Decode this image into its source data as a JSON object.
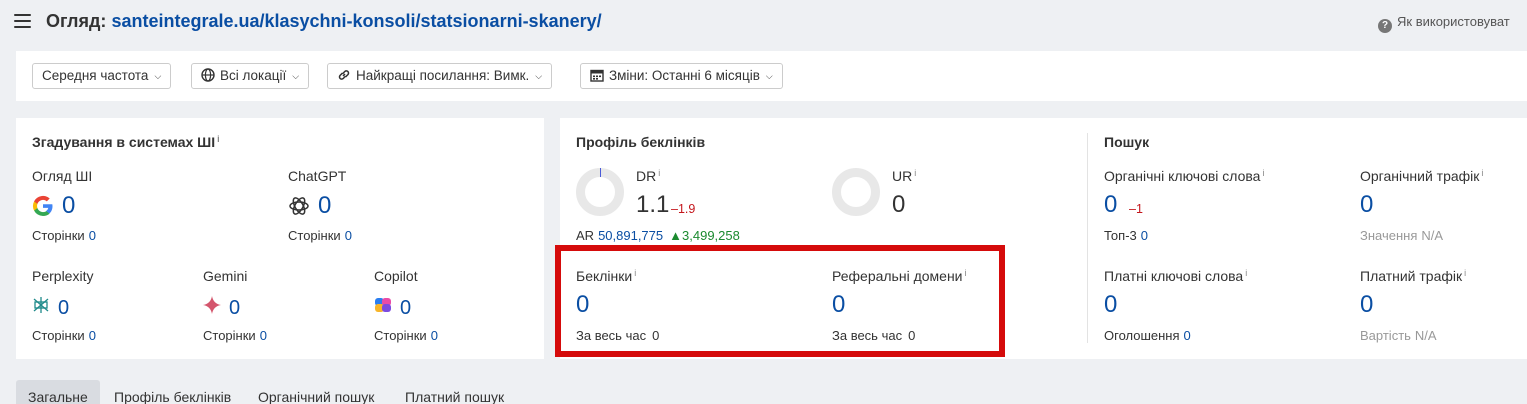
{
  "header": {
    "title_prefix": "Огляд:",
    "title_url": "santeintegrale.ua/klasychni-konsoli/statsionarni-skanery/",
    "help_text": "Як використовуват"
  },
  "filters": [
    {
      "label": "Середня частота",
      "icon": "none"
    },
    {
      "label": "Всі локації",
      "icon": "globe-icon"
    },
    {
      "label": "Найкращі посилання: Вимк.",
      "icon": "link-icon"
    },
    {
      "label": "Зміни: Останні 6 місяців",
      "icon": "calendar-icon"
    }
  ],
  "ai": {
    "title": "Згадування в системах ШІ",
    "info": "i",
    "items": [
      {
        "name": "Огляд ШІ",
        "value": "0",
        "pages_label": "Сторінки",
        "pages_value": "0",
        "icon": "google-icon"
      },
      {
        "name": "ChatGPT",
        "value": "0",
        "pages_label": "Сторінки",
        "pages_value": "0",
        "icon": "chatgpt-icon"
      },
      {
        "name": "Perplexity",
        "value": "0",
        "pages_label": "Сторінки",
        "pages_value": "0",
        "icon": "perplexity-icon"
      },
      {
        "name": "Gemini",
        "value": "0",
        "pages_label": "Сторінки",
        "pages_value": "0",
        "icon": "gemini-icon"
      },
      {
        "name": "Copilot",
        "value": "0",
        "pages_label": "Сторінки",
        "pages_value": "0",
        "icon": "copilot-icon"
      }
    ]
  },
  "backlinks": {
    "title": "Профіль беклінків",
    "dr": {
      "label": "DR",
      "value": "1.1",
      "delta": "–1.9"
    },
    "ur": {
      "label": "UR",
      "value": "0"
    },
    "ar": {
      "label": "AR",
      "value": "50,891,775",
      "delta": "3,499,258"
    },
    "backlinks": {
      "label": "Беклінки",
      "value": "0",
      "sub_label": "За весь час",
      "sub_value": "0"
    },
    "ref_domains": {
      "label": "Реферальні домени",
      "value": "0",
      "sub_label": "За весь час",
      "sub_value": "0"
    }
  },
  "search": {
    "title": "Пошук",
    "organic_kw": {
      "label": "Органічні ключові слова",
      "value": "0",
      "delta": "–1",
      "sub_label": "Топ-3",
      "sub_value": "0"
    },
    "organic_traffic": {
      "label": "Органічний трафік",
      "value": "0",
      "sub_label": "Значення",
      "sub_value": "N/A"
    },
    "paid_kw": {
      "label": "Платні ключові слова",
      "value": "0",
      "sub_label": "Оголошення",
      "sub_value": "0"
    },
    "paid_traffic": {
      "label": "Платний трафік",
      "value": "0",
      "sub_label": "Вартість",
      "sub_value": "N/A"
    }
  },
  "tabs": [
    "Загальне",
    "Профіль беклінків",
    "Органічний пошук",
    "Платний пошук"
  ],
  "colors": {
    "link": "#0a4ea3",
    "negative": "#c4161c",
    "positive": "#1b8a2f",
    "highlight": "#d50b0b"
  }
}
